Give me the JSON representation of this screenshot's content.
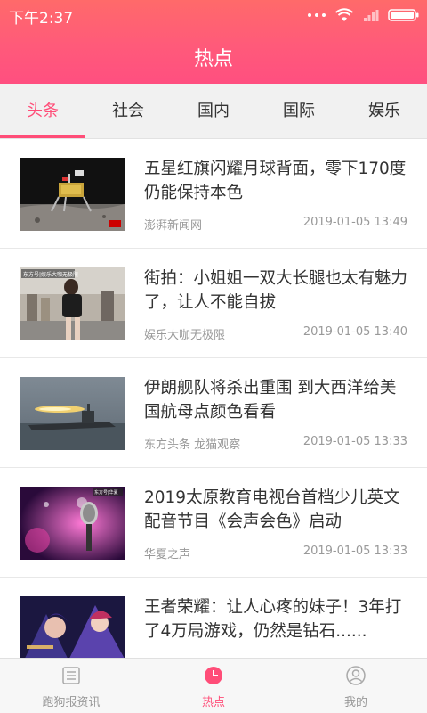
{
  "status": {
    "time": "下午2:37"
  },
  "header": {
    "title": "热点"
  },
  "tabs": [
    {
      "label": "头条",
      "active": true
    },
    {
      "label": "社会"
    },
    {
      "label": "国内"
    },
    {
      "label": "国际"
    },
    {
      "label": "娱乐"
    }
  ],
  "news": [
    {
      "title": "五星红旗闪耀月球背面，零下170度仍能保持本色",
      "source": "澎湃新闻网",
      "time": "2019-01-05 13:49",
      "thumb": "lunar-lander"
    },
    {
      "title": "街拍：小姐姐一双大长腿也太有魅力了，让人不能自拔",
      "source": "娱乐大咖无极限",
      "time": "2019-01-05 13:40",
      "thumb": "street-photo",
      "thumb_text": "东方号|娱乐大咖无极限"
    },
    {
      "title": "伊朗舰队将杀出重围 到大西洋给美国航母点颜色看看",
      "source": "东方头条 龙猫观察",
      "time": "2019-01-05 13:33",
      "thumb": "warship"
    },
    {
      "title": "2019太原教育电视台首档少儿英文配音节目《会声会色》启动",
      "source": "华夏之声",
      "time": "2019-01-05 13:33",
      "thumb": "microphone",
      "thumb_text": "东方号|华夏"
    },
    {
      "title": "王者荣耀：让人心疼的妹子！3年打了4万局游戏，仍然是钻石......",
      "source": "",
      "time": "",
      "thumb": "game-art"
    }
  ],
  "bottom_nav": [
    {
      "label": "跑狗报资讯",
      "icon": "list-icon"
    },
    {
      "label": "热点",
      "icon": "clock-icon",
      "active": true
    },
    {
      "label": "我的",
      "icon": "user-icon"
    }
  ],
  "colors": {
    "accent": "#ff4d78",
    "header_top": "#ff6a6a",
    "header_bottom": "#ff4f80"
  }
}
